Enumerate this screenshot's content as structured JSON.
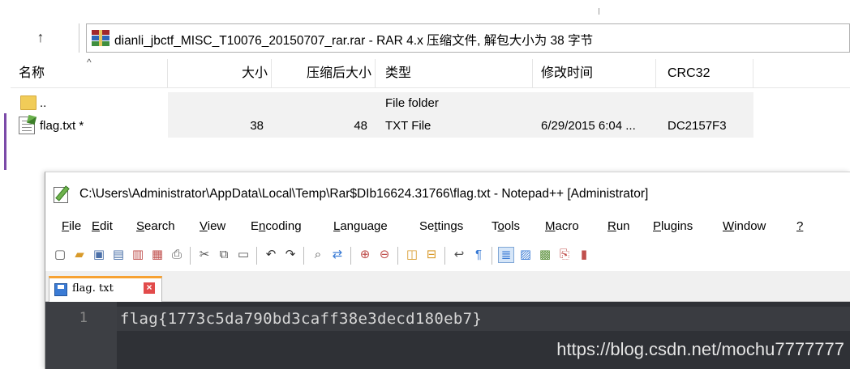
{
  "rar": {
    "path_text": "dianli_jbctf_MISC_T10076_20150707_rar.rar - RAR 4.x 压缩文件, 解包大小为 38 字节",
    "up_icon": "arrow-up-icon",
    "archive_icon": "winrar-archive-icon",
    "columns": {
      "name": "名称",
      "size": "大小",
      "packed": "压缩后大小",
      "type": "类型",
      "modified": "修改时间",
      "crc": "CRC32"
    },
    "sort_indicator": "^",
    "rows": [
      {
        "name": "..",
        "size": "",
        "packed": "",
        "type": "File folder",
        "modified": "",
        "crc": "",
        "icon": "folder-icon"
      },
      {
        "name": "flag.txt *",
        "size": "38",
        "packed": "48",
        "type": "TXT File",
        "modified": "6/29/2015 6:04 ...",
        "crc": "DC2157F3",
        "icon": "text-file-icon"
      }
    ]
  },
  "npp": {
    "title": "C:\\Users\\Administrator\\AppData\\Local\\Temp\\Rar$DIb16624.31766\\flag.txt - Notepad++ [Administrator]",
    "menu": {
      "file": {
        "u": "F",
        "rest": "ile"
      },
      "edit": {
        "u": "E",
        "rest": "dit"
      },
      "search": {
        "u": "S",
        "rest": "earch"
      },
      "view": {
        "u": "V",
        "rest": "iew"
      },
      "encoding": {
        "pre": "E",
        "u": "n",
        "rest": "coding"
      },
      "language": {
        "u": "L",
        "rest": "anguage"
      },
      "settings": {
        "pre": "Se",
        "u": "t",
        "rest": "tings"
      },
      "tools": {
        "pre": "T",
        "u": "o",
        "rest": "ols"
      },
      "macro": {
        "u": "M",
        "rest": "acro"
      },
      "run": {
        "u": "R",
        "rest": "un"
      },
      "plugins": {
        "u": "P",
        "rest": "lugins"
      },
      "window": {
        "u": "W",
        "rest": "indow"
      },
      "help": {
        "u": "?",
        "rest": ""
      }
    },
    "tab_label": "flag. txt",
    "tab_close": "×",
    "line_number": "1",
    "line_text": "flag{1773c5da790bd3caff38e3decd180eb7}"
  },
  "watermark": "https://blog.csdn.net/mochu7777777"
}
